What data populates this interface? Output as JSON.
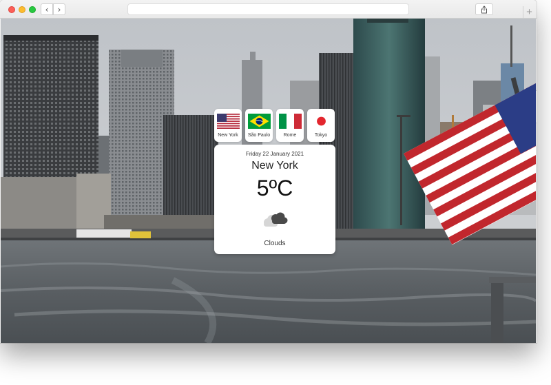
{
  "browser": {
    "back_label": "‹",
    "forward_label": "›",
    "new_tab_label": "+",
    "share_icon": "share-icon",
    "tabs_icon": "tabs-overview-icon"
  },
  "weather": {
    "cities": [
      {
        "label": "New York",
        "flag": "usa-flag-icon"
      },
      {
        "label": "São Paulo",
        "flag": "brazil-flag-icon"
      },
      {
        "label": "Rome",
        "flag": "italy-flag-icon"
      },
      {
        "label": "Tokyo",
        "flag": "japan-flag-icon"
      }
    ],
    "selected": 0,
    "date": "Friday 22 January 2021",
    "city": "New York",
    "temperature": "5ºC",
    "condition_icon": "clouds-icon",
    "condition": "Clouds"
  }
}
